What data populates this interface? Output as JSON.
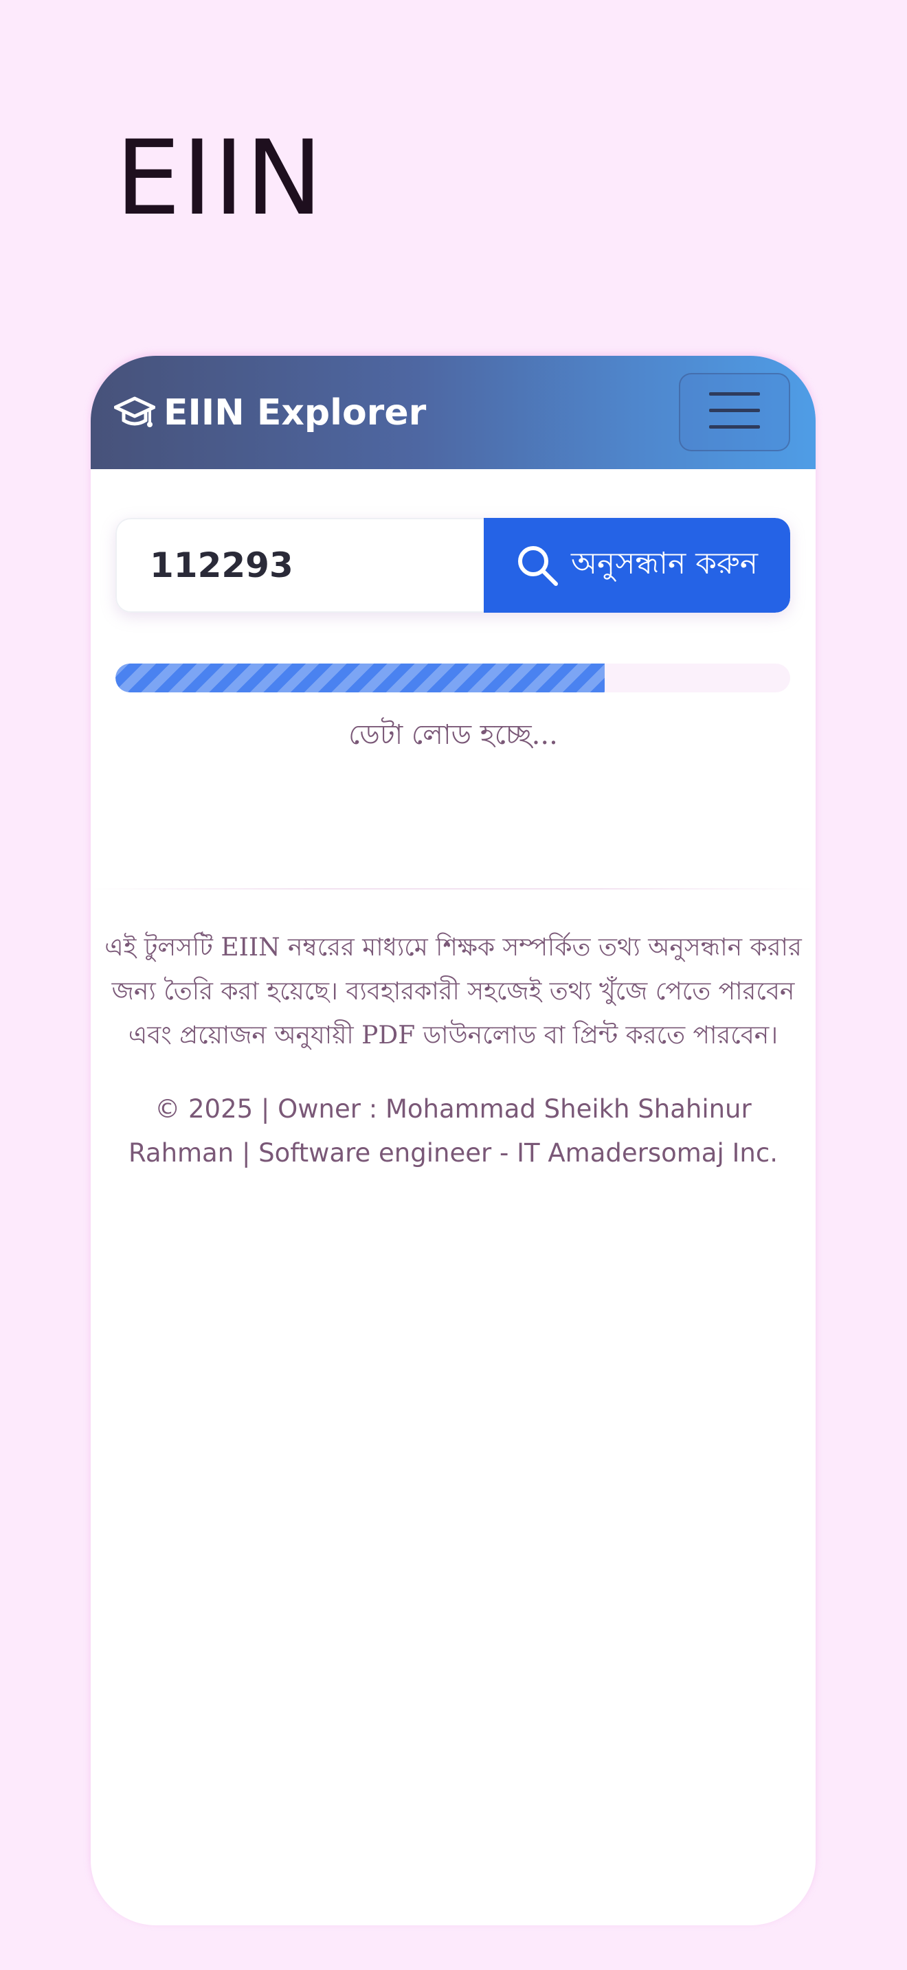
{
  "page": {
    "title": "EIIN"
  },
  "navbar": {
    "brand_text": "EIIN Explorer",
    "brand_icon": "graduation-cap-icon",
    "menu_icon": "hamburger-menu-icon"
  },
  "search": {
    "input_value": "112293",
    "button_label": "অনুসন্ধান করুন",
    "button_icon": "search-icon"
  },
  "progress": {
    "value_percent": 72.5,
    "status_text": "ডেটা লোড হচ্ছে..."
  },
  "footer": {
    "description": "এই টুলসটি EIIN নম্বরের মাধ্যমে শিক্ষক সম্পর্কিত তথ্য অনুসন্ধান করার জন্য তৈরি করা হয়েছে। ব্যবহারকারী সহজেই তথ্য খুঁজে পেতে পারবেন এবং প্রয়োজন অনুযায়ী PDF ডাউনলোড বা প্রিন্ট করতে পারবেন।",
    "copyright": "© 2025 | Owner : Mohammad Sheikh Shahinur Rahman | Software engineer - IT Amadersomaj Inc."
  },
  "colors": {
    "background": "#fdeafc",
    "navbar_start": "#47527a",
    "navbar_end": "#4f9de6",
    "button": "#2563e6",
    "progress": "#4a82f0",
    "muted_text": "#7a5877"
  }
}
